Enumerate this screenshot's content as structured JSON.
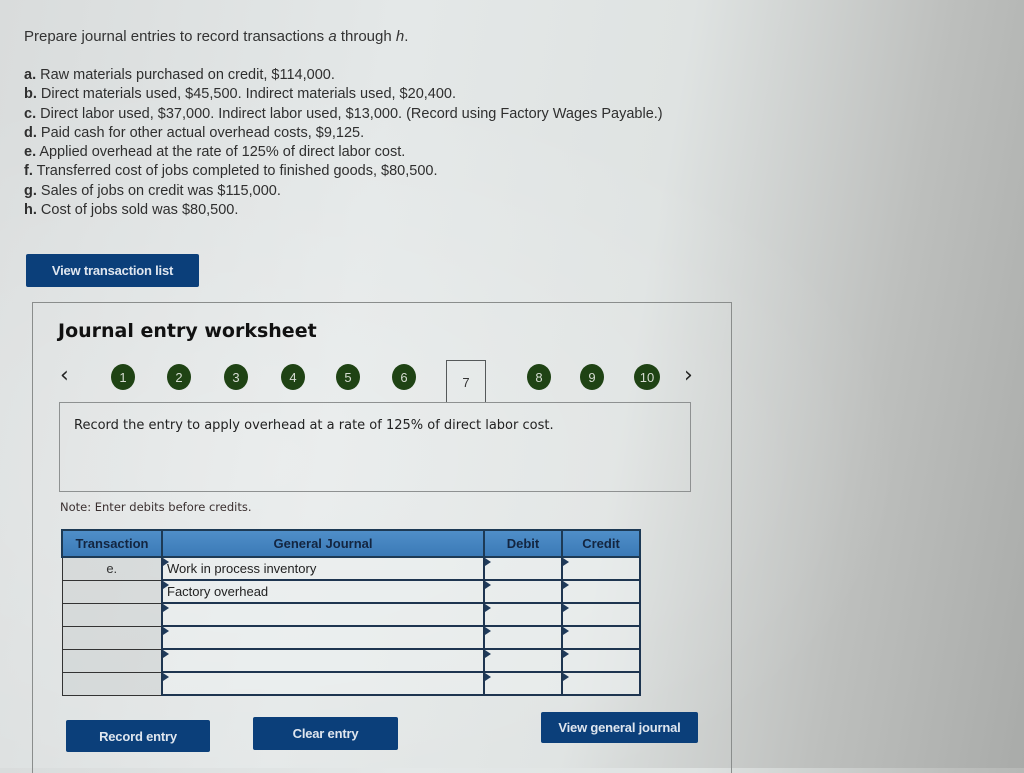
{
  "instructions": {
    "prompt_prefix": "Prepare journal entries to record transactions ",
    "prompt_a": "a",
    "prompt_mid": " through ",
    "prompt_h": "h",
    "prompt_end": ".",
    "transactions": [
      {
        "letter": "a.",
        "text": " Raw materials purchased on credit, $114,000."
      },
      {
        "letter": "b.",
        "text": " Direct materials used, $45,500. Indirect materials used, $20,400."
      },
      {
        "letter": "c.",
        "text": " Direct labor used, $37,000. Indirect labor used, $13,000. (Record using Factory Wages Payable.)"
      },
      {
        "letter": "d.",
        "text": " Paid cash for other actual overhead costs, $9,125."
      },
      {
        "letter": "e.",
        "text": " Applied overhead at the rate of 125% of direct labor cost."
      },
      {
        "letter": "f.",
        "text": " Transferred cost of jobs completed to finished goods, $80,500."
      },
      {
        "letter": "g.",
        "text": " Sales of jobs on credit was $115,000."
      },
      {
        "letter": "h.",
        "text": " Cost of jobs sold was $80,500."
      }
    ]
  },
  "buttons": {
    "view_transaction_list": "View transaction list",
    "record_entry": "Record entry",
    "clear_entry": "Clear entry",
    "view_general_journal": "View general journal"
  },
  "worksheet": {
    "title": "Journal entry worksheet",
    "nav_prev": "‹",
    "nav_next": "›",
    "steps": [
      "1",
      "2",
      "3",
      "4",
      "5",
      "6",
      "7",
      "8",
      "9",
      "10"
    ],
    "active_step": "7",
    "prompt": "Record the entry to apply overhead at a rate of 125% of direct labor cost.",
    "note": "Note: Enter debits before credits."
  },
  "journal": {
    "headers": {
      "transaction": "Transaction",
      "general_journal": "General Journal",
      "debit": "Debit",
      "credit": "Credit"
    },
    "rows": [
      {
        "transaction": "e.",
        "account": "Work in process inventory",
        "debit": "",
        "credit": ""
      },
      {
        "transaction": "",
        "account": "Factory overhead",
        "debit": "",
        "credit": ""
      },
      {
        "transaction": "",
        "account": "",
        "debit": "",
        "credit": ""
      },
      {
        "transaction": "",
        "account": "",
        "debit": "",
        "credit": ""
      },
      {
        "transaction": "",
        "account": "",
        "debit": "",
        "credit": ""
      },
      {
        "transaction": "",
        "account": "",
        "debit": "",
        "credit": ""
      }
    ]
  },
  "colors": {
    "button_bg": "#0b3f7a",
    "step_bg": "#1f4314",
    "table_header_bg": "#4f8ec8"
  }
}
